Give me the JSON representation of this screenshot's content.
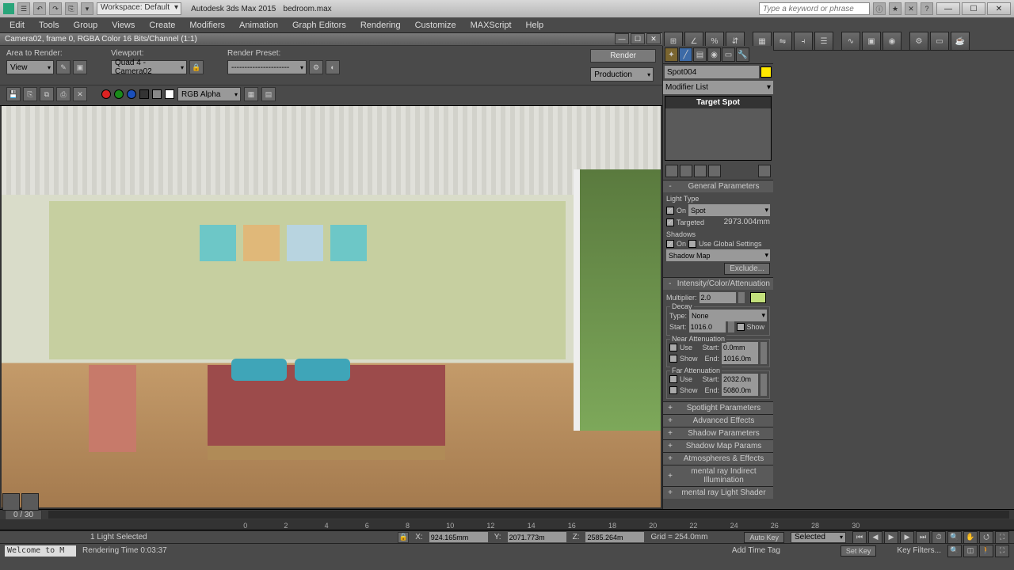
{
  "title": {
    "workspace_label": "Workspace: Default",
    "app": "Autodesk 3ds Max 2015",
    "file": "bedroom.max",
    "search_placeholder": "Type a keyword or phrase"
  },
  "menu": [
    "Edit",
    "Tools",
    "Group",
    "Views",
    "Create",
    "Modifiers",
    "Animation",
    "Graph Editors",
    "Rendering",
    "Customize",
    "MAXScript",
    "Help"
  ],
  "render_frame": {
    "caption": "Camera02, frame 0, RGBA Color 16 Bits/Channel (1:1)",
    "area_label": "Area to Render:",
    "area_value": "View",
    "viewport_label": "Viewport:",
    "viewport_value": "Quad 4 - Camera02",
    "preset_label": "Render Preset:",
    "preset_value": "----------------------",
    "render_btn": "Render",
    "output_value": "Production",
    "channel_value": "RGB Alpha"
  },
  "command_panel": {
    "object_name": "Spot004",
    "modifier_list": "Modifier List",
    "stack_item": "Target Spot",
    "general": {
      "title": "General Parameters",
      "light_type_label": "Light Type",
      "on": "On",
      "type_value": "Spot",
      "targeted_label": "Targeted",
      "targeted_value": "2973.004mm",
      "shadows_label": "Shadows",
      "use_global": "Use Global Settings",
      "shadow_type": "Shadow Map",
      "exclude": "Exclude..."
    },
    "intensity": {
      "title": "Intensity/Color/Attenuation",
      "multiplier_label": "Multiplier:",
      "multiplier_value": "2.0",
      "decay_label": "Decay",
      "type_label": "Type:",
      "type_value": "None",
      "start_label": "Start:",
      "start_value": "1016.0",
      "show": "Show",
      "near_label": "Near Attenuation",
      "use": "Use",
      "near_start": "0.0mm",
      "end": "End:",
      "near_end": "1016.0m",
      "far_label": "Far Attenuation",
      "far_start": "2032.0m",
      "far_end": "5080.0m"
    },
    "collapsed": [
      "Spotlight Parameters",
      "Advanced Effects",
      "Shadow Parameters",
      "Shadow Map Params",
      "Atmospheres & Effects",
      "mental ray Indirect Illumination",
      "mental ray Light Shader"
    ]
  },
  "timeline": {
    "indicator": "0 / 30"
  },
  "status": {
    "selection": "1 Light Selected",
    "x": "924.165mm",
    "y": "2071.773m",
    "z": "2585.264m",
    "grid": "Grid = 254.0mm",
    "autokey": "Auto Key",
    "selected": "Selected",
    "setkey": "Set Key",
    "keyfilters": "Key Filters...",
    "add_time_tag": "Add Time Tag"
  },
  "bottom": {
    "prompt": "Welcome to M",
    "render_time": "Rendering Time 0:03:37"
  },
  "ticks": [
    "0",
    "2",
    "4",
    "6",
    "8",
    "10",
    "12",
    "14",
    "16",
    "18",
    "20",
    "22",
    "24",
    "26",
    "28",
    "30"
  ]
}
